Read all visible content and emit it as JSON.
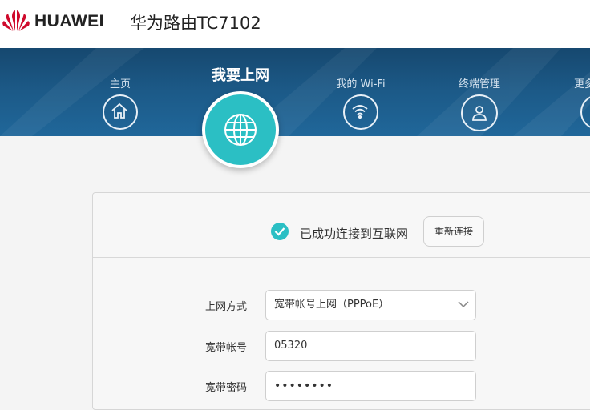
{
  "header": {
    "brand": "HUAWEI",
    "router_title": "华为路由TC7102"
  },
  "nav": {
    "items": [
      {
        "label": "主页",
        "icon": "home-icon"
      },
      {
        "label": "我要上网",
        "icon": "globe-icon",
        "active": true
      },
      {
        "label": "我的 Wi-Fi",
        "icon": "wifi-icon"
      },
      {
        "label": "终端管理",
        "icon": "user-icon"
      },
      {
        "label": "更多",
        "icon": "more-icon"
      }
    ]
  },
  "status": {
    "text": "已成功连接到互联网",
    "reconnect_label": "重新连接"
  },
  "form": {
    "mode_label": "上网方式",
    "mode_value": "宽带帐号上网（PPPoE）",
    "account_label": "宽带帐号",
    "account_value": "05320",
    "password_label": "宽带密码",
    "password_value": "••••••••"
  },
  "colors": {
    "accent": "#2bbfc4",
    "nav_band": "#1c5a88",
    "brand_red": "#cf0a2c"
  }
}
